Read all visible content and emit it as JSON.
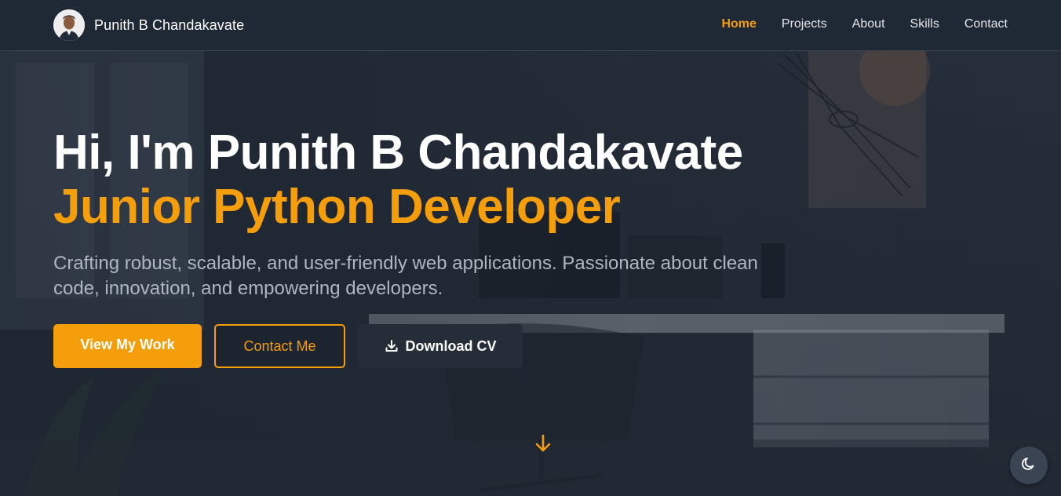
{
  "brand": {
    "name": "Punith B Chandakavate",
    "avatar_icon": "profile-photo"
  },
  "nav": {
    "items": [
      {
        "label": "Home",
        "active": true
      },
      {
        "label": "Projects",
        "active": false
      },
      {
        "label": "About",
        "active": false
      },
      {
        "label": "Skills",
        "active": false
      },
      {
        "label": "Contact",
        "active": false
      }
    ]
  },
  "hero": {
    "title": "Hi, I'm Punith B Chandakavate",
    "role": "Junior Python Developer",
    "description": "Crafting robust, scalable, and user-friendly web applications. Passionate about clean code, innovation, and empowering developers."
  },
  "buttons": {
    "view_work": "View My Work",
    "contact": "Contact Me",
    "download_cv": "Download CV"
  },
  "icons": {
    "scroll": "arrow-down-icon",
    "theme": "moon-icon",
    "download": "download-icon"
  },
  "colors": {
    "accent": "#f59e0b",
    "navbar": "#1f2835",
    "text_muted": "#aeb6c2"
  }
}
